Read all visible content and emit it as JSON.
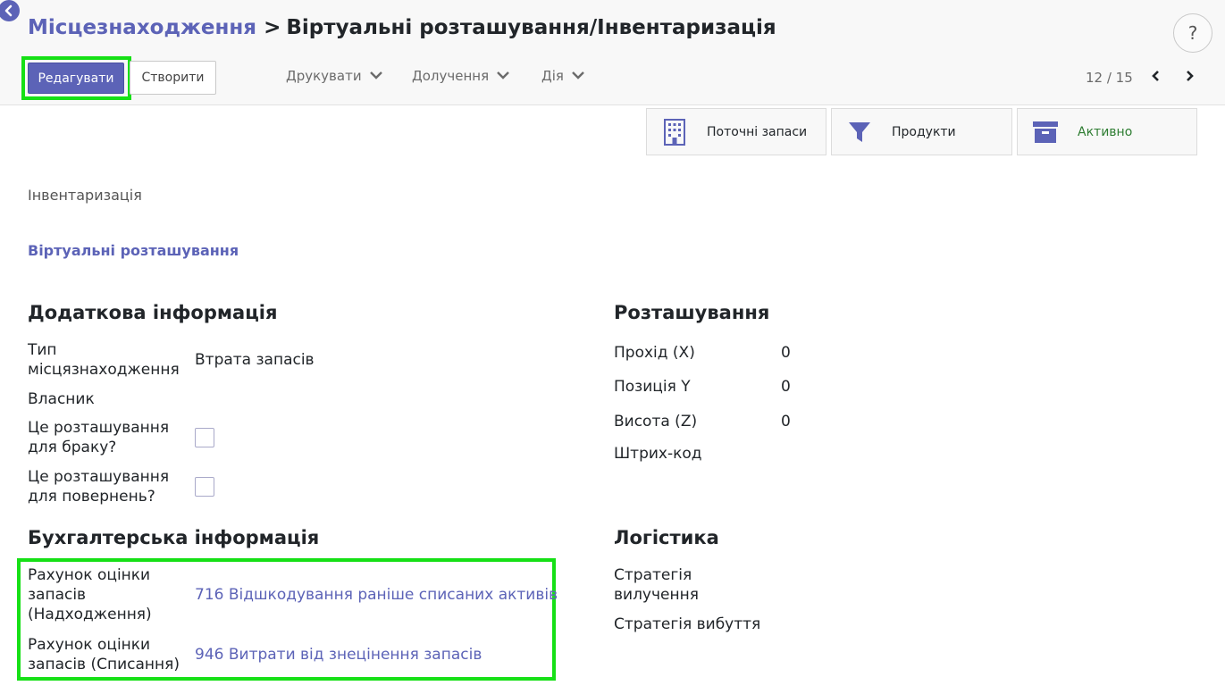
{
  "breadcrumb": {
    "parent": "Місцезнаходження",
    "separator": ">",
    "current": "Віртуальні розташування/Інвентаризація"
  },
  "help": {
    "label": "?"
  },
  "toolbar": {
    "edit_label": "Редагувати",
    "create_label": "Створити",
    "print_label": "Друкувати",
    "attachments_label": "Долучення",
    "action_label": "Дія"
  },
  "pager": {
    "value": "12 / 15"
  },
  "smart_buttons": {
    "stock_label": "Поточні запаси",
    "products_label": "Продукти",
    "active_label": "Активно"
  },
  "record": {
    "name": "Інвентаризація",
    "parent_location": "Віртуальні розташування"
  },
  "additional_info": {
    "title": "Додаткова інформація",
    "type_label": "Тип місцязнаходження",
    "type_value": "Втрата запасів",
    "owner_label": "Власник",
    "scrap_label": "Це розташування для браку?",
    "scrap_checked": false,
    "return_label": "Це розташування для повернень?",
    "return_checked": false
  },
  "location": {
    "title": "Розташування",
    "x_label": "Прохід (X)",
    "x_value": "0",
    "y_label": "Позиція Y",
    "y_value": "0",
    "z_label": "Висота (Z)",
    "z_value": "0",
    "barcode_label": "Штрих-код"
  },
  "accounting": {
    "title": "Бухгалтерська інформація",
    "incoming_label": "Рахунок оцінки запасів (Надходження)",
    "incoming_value": "716 Відшкодування раніше списаних активів",
    "outgoing_label": "Рахунок оцінки запасів (Списання)",
    "outgoing_value": "946 Витрати від знецінення запасів"
  },
  "logistics": {
    "title": "Логістика",
    "removal_label": "Стратегія вилучення",
    "putaway_label": "Стратегія вибуття"
  },
  "colors": {
    "primary": "#5c63b7",
    "highlight": "#16e016",
    "active": "#2e7d32"
  }
}
